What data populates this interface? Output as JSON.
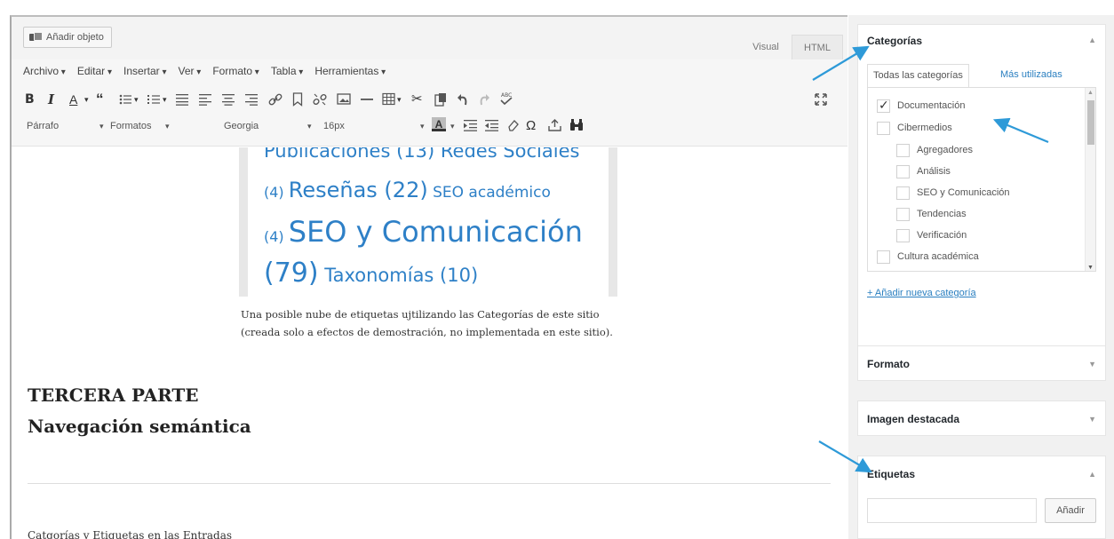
{
  "editor": {
    "add_object_label": "Añadir objeto",
    "tabs": {
      "visual": "Visual",
      "html": "HTML"
    },
    "menu": [
      "Archivo",
      "Editar",
      "Insertar",
      "Ver",
      "Formato",
      "Tabla",
      "Herramientas"
    ],
    "toolbar1_icons": [
      "bold-icon",
      "italic-icon",
      "text-color-icon",
      "blockquote-icon",
      "bullet-list-icon",
      "numbered-list-icon",
      "align-justify-icon",
      "align-left-icon",
      "align-center-icon",
      "align-right-icon",
      "link-icon",
      "bookmark-icon",
      "unlink-icon",
      "image-icon",
      "horizontal-rule-icon",
      "table-icon",
      "cut-icon",
      "paste-icon",
      "undo-icon",
      "redo-icon",
      "spellcheck-icon",
      "fullscreen-icon"
    ],
    "toolbar1_glyphs": {
      "bold": "B",
      "italic": "I",
      "color": "A"
    },
    "toolbar2": {
      "paragraph": "Párrafo",
      "formats": "Formatos",
      "font": "Georgia",
      "size": "16px"
    },
    "toolbar2_icons": [
      "bg-color-icon",
      "indent-icon",
      "outdent-icon",
      "eraser-icon",
      "omega-icon",
      "upload-icon",
      "binoculars-icon"
    ]
  },
  "content": {
    "tag_cloud": {
      "line1": "Publicaciones (13) Redes Sociales",
      "line2_a": "(4) ",
      "line2_b": "Reseñas (22)",
      "line2_c": " SEO académico",
      "line3_a": "(4) ",
      "line3_b": "SEO y Comunicación",
      "line4_a": "(79)",
      "line4_b": " Taxonomías (10)"
    },
    "caption": "Una posible nube de etiquetas ujtilizando las Categorías de este sitio (creada solo a efectos de demostración, no implementada en este sitio).",
    "heading1": "TERCERA PARTE",
    "heading2": "Navegación semántica",
    "paragraph": "Catgorías y Etiquetas en las Entradas"
  },
  "sidebar": {
    "categories": {
      "title": "Categorías",
      "tab_all": "Todas las categorías",
      "tab_used": "Más utilizadas",
      "items": [
        {
          "label": "Documentación",
          "checked": true,
          "level": 0
        },
        {
          "label": "Cibermedios",
          "checked": false,
          "level": 0
        },
        {
          "label": "Agregadores",
          "checked": false,
          "level": 1
        },
        {
          "label": "Análisis",
          "checked": false,
          "level": 1
        },
        {
          "label": "SEO y Comunicación",
          "checked": false,
          "level": 1
        },
        {
          "label": "Tendencias",
          "checked": false,
          "level": 1
        },
        {
          "label": "Verificación",
          "checked": false,
          "level": 1
        },
        {
          "label": "Cultura académica",
          "checked": false,
          "level": 0
        }
      ],
      "add_new": "+ Añadir nueva categoría"
    },
    "format": {
      "title": "Formato"
    },
    "featured_image": {
      "title": "Imagen destacada"
    },
    "tags": {
      "title": "Etiquetas",
      "add_label": "Añadir",
      "input_value": ""
    }
  },
  "colors": {
    "link": "#2a7fc0",
    "cloud": "#2e80c7",
    "arrow": "#2e9ad8",
    "sidebar_bg": "#f1f1f1"
  }
}
